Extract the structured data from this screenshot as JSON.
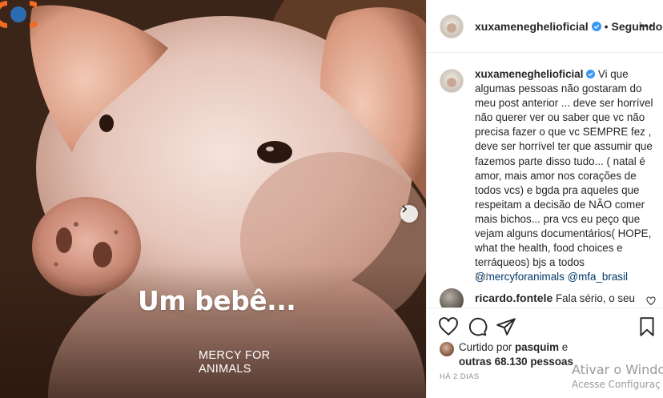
{
  "media": {
    "overlay_text": "Um bebê...",
    "brand_line1": "MERCY FOR",
    "brand_line2": "ANIMALS",
    "next_icon": "chevron-right-icon"
  },
  "header": {
    "username": "xuxameneghelioficial",
    "separator": "•",
    "follow_state": "Seguindo",
    "more_icon": "ellipsis-icon"
  },
  "caption": {
    "username": "xuxameneghelioficial",
    "text": "Vi que algumas pessoas não gostaram do meu post anterior ... deve ser horrível não querer ver ou saber que vc não precisa fazer o que vc SEMPRE fez , deve ser horrível ter que assumir que fazemos parte disso tudo... ( natal é amor, mais amor nos corações de todos vcs) e bgda pra aqueles que respeitam a decisão de NÃO comer mais bichos... pra vcs eu peço que vejam alguns documentários( HOPE, what the health, food choices e terráqueos) bjs a todos",
    "mention1": "@mercyforanimals",
    "mention2": "@mfa_brasil",
    "age": "2 d"
  },
  "comment": {
    "username": "ricardo.fontele",
    "text": "Fala sério, o seu"
  },
  "actions": {
    "like_icon": "heart-icon",
    "comment_icon": "comment-icon",
    "share_icon": "paper-plane-icon",
    "save_icon": "bookmark-icon"
  },
  "likes": {
    "prefix": "Curtido por",
    "user": "pasquim",
    "connector": "e",
    "others": "outras 68.130 pessoas"
  },
  "timestamp": "HÁ 2 DIAS",
  "watermark": {
    "title": "Ativar o Windo",
    "subtitle": "Acesse Configuraç"
  },
  "colors": {
    "verified_blue": "#3897f0",
    "mfa_orange": "#f26b21",
    "mfa_blue": "#2b6cb0",
    "link_blue": "#00376b",
    "muted_gray": "#8e8e8e"
  }
}
